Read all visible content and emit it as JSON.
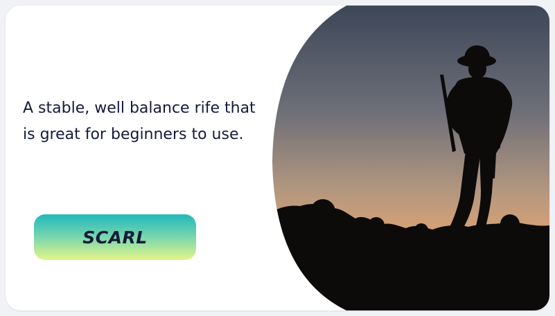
{
  "card": {
    "description": "A stable, well balance rife that is great for beginners to use.",
    "button_label": "SCARL"
  },
  "hero": {
    "subject": "soldier-silhouette-at-sunset"
  },
  "colors": {
    "text": "#141b3a",
    "button_top": "#22b8bc",
    "button_bottom": "#e4f58a",
    "sky_top": "#3f4a5c",
    "sky_glow": "#e9a874"
  }
}
